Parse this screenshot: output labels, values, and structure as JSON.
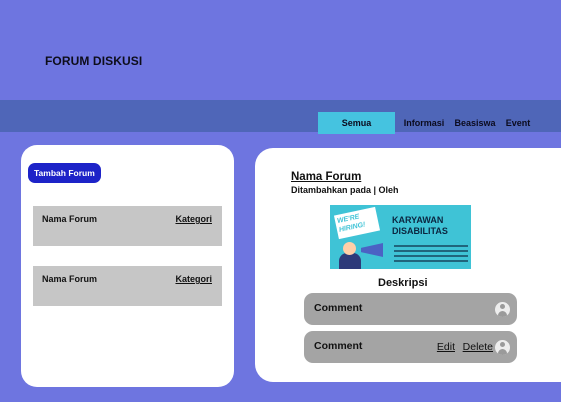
{
  "header": {
    "title": "FORUM DISKUSI"
  },
  "nav": {
    "tabs": [
      {
        "label": "Semua",
        "active": true
      },
      {
        "label": "Informasi",
        "active": false
      },
      {
        "label": "Beasiswa",
        "active": false
      },
      {
        "label": "Event",
        "active": false
      }
    ]
  },
  "sidebar": {
    "add_button_label": "Tambah Forum",
    "forums": [
      {
        "name": "Nama Forum",
        "category": "Kategori"
      },
      {
        "name": "Nama Forum",
        "category": "Kategori"
      }
    ]
  },
  "detail": {
    "title": "Nama Forum",
    "meta": "Ditambahkan pada | Oleh",
    "poster": {
      "badge": "WE'RE HIRING!",
      "headline_line1": "KARYAWAN",
      "headline_line2": "DISABILITAS"
    },
    "description_label": "Deskripsi",
    "comments": [
      {
        "text": "Comment",
        "actions": []
      },
      {
        "text": "Comment",
        "actions": [
          "Edit",
          "Delete"
        ]
      }
    ]
  },
  "colors": {
    "page_bg": "#6e75e0",
    "navbar": "#4f66b8",
    "tab_active": "#45c3e0",
    "add_button": "#1d23c8",
    "card": "#c6c6c6",
    "comment": "#a4a4a4"
  },
  "icons": {
    "comment_avatar": "user-avatar-icon"
  }
}
